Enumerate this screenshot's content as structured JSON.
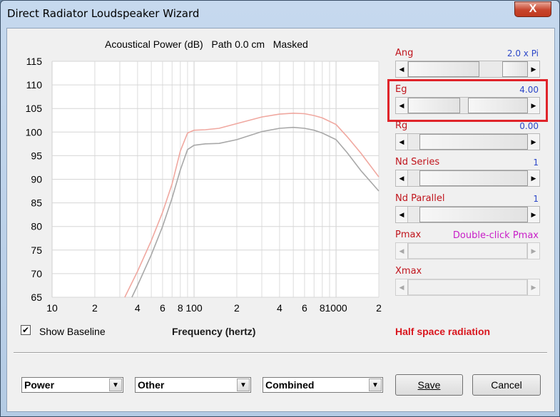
{
  "window": {
    "title": "Direct Radiator Loudspeaker Wizard",
    "close_glyph": "X"
  },
  "chart_data": {
    "type": "line",
    "title": "Acoustical Power (dB)   Path 0.0 cm   Masked",
    "xlabel": "Frequency (hertz)",
    "ylabel": "",
    "x_scale": "log",
    "xlim": [
      10,
      2000
    ],
    "ylim": [
      65,
      115
    ],
    "y_ticks": [
      65,
      70,
      75,
      80,
      85,
      90,
      95,
      100,
      105,
      110,
      115
    ],
    "x_tick_labels": [
      {
        "x": 10,
        "label": "10"
      },
      {
        "x": 20,
        "label": "2"
      },
      {
        "x": 40,
        "label": "4"
      },
      {
        "x": 60,
        "label": "6"
      },
      {
        "x": 80,
        "label": "8"
      },
      {
        "x": 100,
        "label": "100"
      },
      {
        "x": 200,
        "label": "2"
      },
      {
        "x": 400,
        "label": "4"
      },
      {
        "x": 600,
        "label": "6"
      },
      {
        "x": 800,
        "label": "8"
      },
      {
        "x": 1000,
        "label": "1000"
      },
      {
        "x": 2000,
        "label": "2"
      }
    ],
    "series": [
      {
        "color": "#f0a8a0",
        "x": [
          32.5,
          40,
          50,
          60,
          70,
          80,
          90,
          100,
          120,
          150,
          200,
          300,
          400,
          500,
          600,
          700,
          800,
          1000,
          1200,
          1500,
          2000
        ],
        "y": [
          65,
          70.5,
          77,
          83,
          89,
          96,
          99.8,
          100.4,
          100.5,
          100.8,
          101.8,
          103.2,
          103.8,
          104,
          103.9,
          103.5,
          103,
          101.6,
          99,
          95.5,
          90.5
        ]
      },
      {
        "color": "#a8a8a8",
        "x": [
          36.5,
          40,
          50,
          60,
          70,
          80,
          90,
          100,
          120,
          150,
          200,
          300,
          400,
          500,
          600,
          700,
          800,
          1000,
          1200,
          1500,
          2000
        ],
        "y": [
          65,
          67.5,
          74,
          80,
          86,
          92,
          96.3,
          97.2,
          97.5,
          97.6,
          98.4,
          100.1,
          100.8,
          101,
          100.8,
          100.4,
          99.8,
          98.4,
          95.6,
          91.8,
          87.5
        ]
      }
    ]
  },
  "show_baseline": {
    "label": "Show Baseline",
    "checked": true
  },
  "radiation_text": "Half space radiation",
  "params": [
    {
      "label": "Ang",
      "value": "2.0 x Pi",
      "thumb": 0.82,
      "enabled": true
    },
    {
      "label": "Eg",
      "value": "4.00",
      "thumb": 0.52,
      "enabled": true,
      "highlighted": true
    },
    {
      "label": "Rg",
      "value": "0.00",
      "thumb": 0.0,
      "enabled": true
    },
    {
      "label": "Nd  Series",
      "value": "1",
      "thumb": 0.0,
      "enabled": true
    },
    {
      "label": "Nd  Parallel",
      "value": "1",
      "thumb": 0.0,
      "enabled": true
    },
    {
      "label": "Pmax",
      "value": "Double-click Pmax",
      "enabled": false
    },
    {
      "label": "Xmax",
      "value": "",
      "enabled": false
    }
  ],
  "dropdowns": [
    {
      "value": "Power"
    },
    {
      "value": "Other"
    },
    {
      "value": "Combined"
    }
  ],
  "buttons": {
    "save": "Save",
    "cancel": "Cancel"
  },
  "colors": {
    "highlight": "#e0242a",
    "label_red": "#c0141c",
    "value_blue": "#2c47c8",
    "pmax_magenta": "#c81ec8"
  }
}
